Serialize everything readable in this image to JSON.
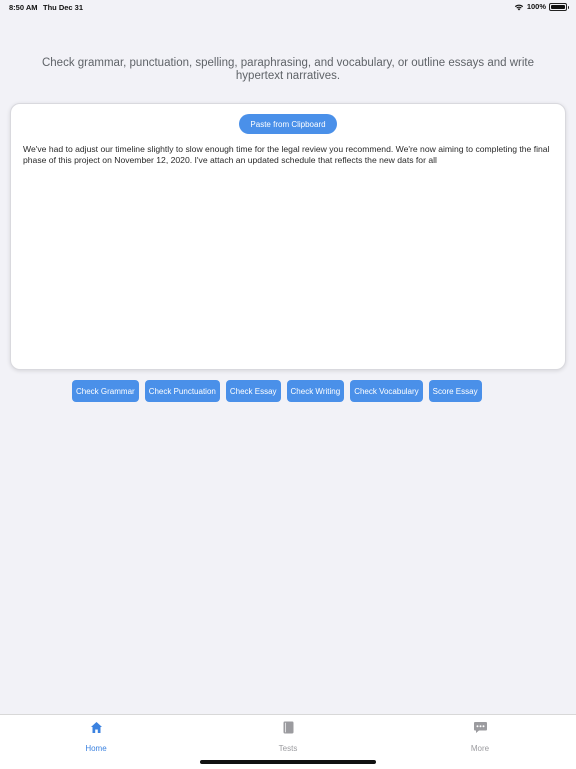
{
  "status_bar": {
    "time": "8:50 AM",
    "date": "Thu Dec 31",
    "battery_text": "100%",
    "battery_level": 1.0
  },
  "description": "Check grammar, punctuation, spelling, paraphrasing, and vocabulary, or outline essays and write hypertext narratives.",
  "editor": {
    "paste_button_label": "Paste from Clipboard",
    "text": "We've had to adjust our timeline slightly to slow enough time for the legal review you recommend. We're now aiming to completing the final phase of this project on November 12, 2020. I've attach an updated schedule that reflects the new dats for all"
  },
  "actions": [
    {
      "label": "Check Grammar"
    },
    {
      "label": "Check Punctuation"
    },
    {
      "label": "Check Essay"
    },
    {
      "label": "Check Writing"
    },
    {
      "label": "Check Vocabulary"
    },
    {
      "label": "Score Essay"
    }
  ],
  "tab_bar": {
    "active_color": "#3b82e0",
    "inactive_color": "#9b9b9f",
    "tabs": [
      {
        "label": "Home",
        "icon": "home-icon",
        "active": true
      },
      {
        "label": "Tests",
        "icon": "book-icon",
        "active": false
      },
      {
        "label": "More",
        "icon": "more-icon",
        "active": false
      }
    ]
  },
  "colors": {
    "accent": "#4a90e9",
    "background": "#f2f2f7"
  }
}
